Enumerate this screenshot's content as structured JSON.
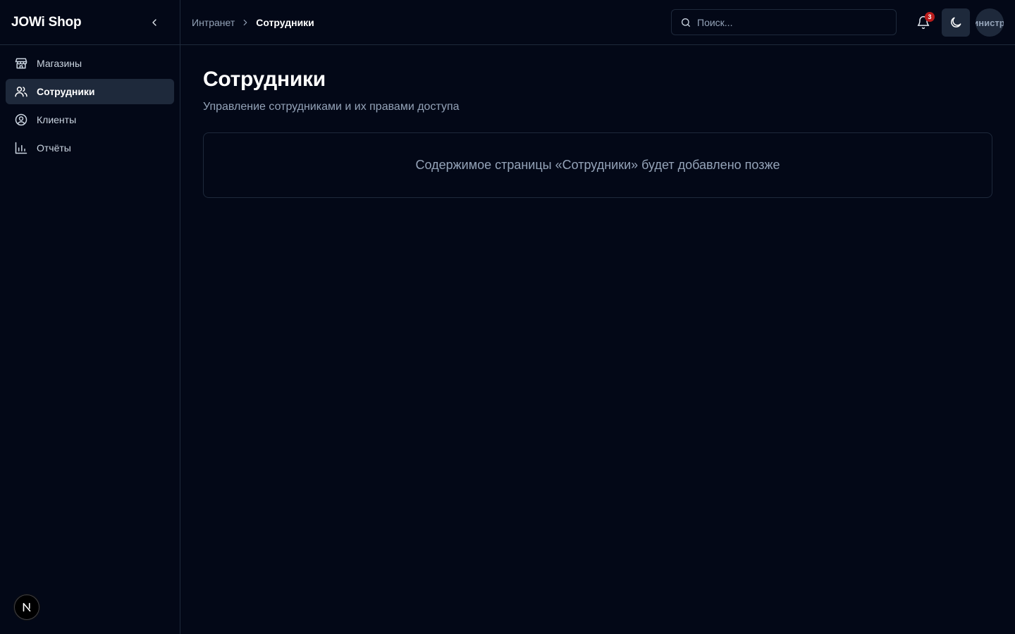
{
  "app": {
    "brand": "JOWi Shop"
  },
  "sidebar": {
    "items": [
      {
        "label": "Магазины",
        "icon": "store-icon",
        "active": false
      },
      {
        "label": "Сотрудники",
        "icon": "users-icon",
        "active": true
      },
      {
        "label": "Клиенты",
        "icon": "user-circle-icon",
        "active": false
      },
      {
        "label": "Отчёты",
        "icon": "bar-chart-icon",
        "active": false
      }
    ],
    "footer_badge": "N"
  },
  "topbar": {
    "breadcrumb": {
      "parent": "Интранет",
      "current": "Сотрудники"
    },
    "search_placeholder": "Поиск...",
    "notifications_count": "3",
    "avatar_text": "Администратор"
  },
  "main": {
    "title": "Сотрудники",
    "subtitle": "Управление сотрудниками и их правами доступа",
    "placeholder_text": "Содержимое страницы «Сотрудники» будет добавлено позже"
  },
  "colors": {
    "background": "#030817",
    "border": "#1e293b",
    "active_item": "#1e293b",
    "muted_text": "#94a3b8",
    "badge": "#b91c1c"
  }
}
